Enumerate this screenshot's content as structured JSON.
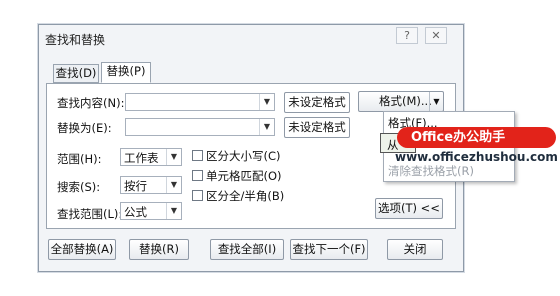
{
  "window": {
    "title": "查找和替换",
    "help_label": "?",
    "close_label": "✕"
  },
  "tabs": [
    {
      "label": "查找(D)"
    },
    {
      "label": "替换(P)"
    }
  ],
  "find": {
    "label": "查找内容(N):",
    "value": "",
    "format_status": "未设定格式"
  },
  "replace": {
    "label": "替换为(E):",
    "value": "",
    "format_status": "未设定格式"
  },
  "format_button": {
    "label": "格式(M)..."
  },
  "format_menu": {
    "items": [
      {
        "label": "格式(F)..."
      },
      {
        "label": "从"
      },
      {
        "label": "清除查找格式(R)"
      }
    ]
  },
  "options": {
    "scope": {
      "label": "范围(H):",
      "value": "工作表"
    },
    "search": {
      "label": "搜索(S):",
      "value": "按行"
    },
    "look_in": {
      "label": "查找范围(L):",
      "value": "公式"
    },
    "match_case": {
      "label": "区分大小写(C)",
      "checked": false
    },
    "match_cell": {
      "label": "单元格匹配(O)",
      "checked": false
    },
    "match_width": {
      "label": "区分全/半角(B)",
      "checked": false
    },
    "options_button": "选项(T) <<"
  },
  "buttons": {
    "replace_all": "全部替换(A)",
    "replace": "替换(R)",
    "find_all": "查找全部(I)",
    "find_next": "查找下一个(F)",
    "close": "关闭"
  },
  "watermark": {
    "badge_text": "Office办公助手",
    "url": "www.officezhushou.com"
  },
  "colors": {
    "badge": "#e2231a",
    "dialog_bg": "#f2f4f7",
    "border": "#8e9aa8"
  }
}
